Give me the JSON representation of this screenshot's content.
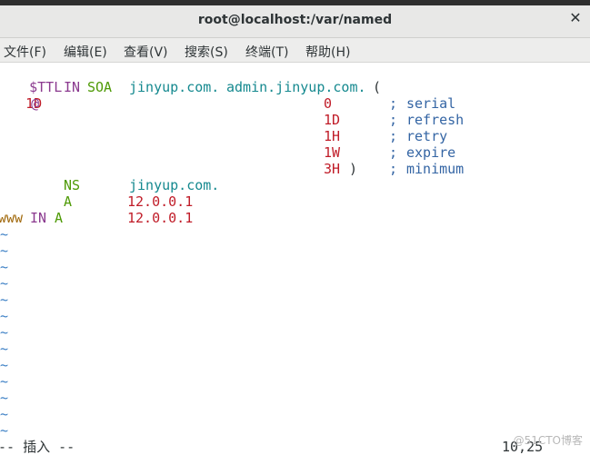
{
  "window": {
    "title": "root@localhost:/var/named",
    "close_glyph": "✕"
  },
  "menu": [
    {
      "label": "文件(F)"
    },
    {
      "label": "编辑(E)"
    },
    {
      "label": "查看(V)"
    },
    {
      "label": "搜索(S)"
    },
    {
      "label": "终端(T)"
    },
    {
      "label": "帮助(H)"
    }
  ],
  "editor": {
    "l1": {
      "a": "$TTL",
      "b": "1D"
    },
    "l2": {
      "at": "@",
      "in": "IN",
      "soa": "SOA",
      "domain": "jinyup.com.",
      "admin": "admin.jinyup.com.",
      "paren": "("
    },
    "l3": {
      "val": "0",
      "semi": ";",
      "name": "serial"
    },
    "l4": {
      "val": "1D",
      "semi": ";",
      "name": "refresh"
    },
    "l5": {
      "val": "1H",
      "semi": ";",
      "name": "retry"
    },
    "l6": {
      "val": "1W",
      "semi": ";",
      "name": "expire"
    },
    "l7": {
      "val": "3H",
      "close": ")",
      "semi": ";",
      "name": "minimum"
    },
    "l8": {
      "type": "NS",
      "value": "jinyup.com."
    },
    "l9": {
      "type": "A",
      "value": "12.0.0.1"
    },
    "l10": {
      "host": "www",
      "in": "IN",
      "type": "A",
      "value": "12.0.0.1"
    },
    "tilde": "~",
    "tilde_count": 13
  },
  "status": {
    "mode": "-- 插入 --",
    "position": "10,25"
  },
  "watermark": "@51CTO博客"
}
